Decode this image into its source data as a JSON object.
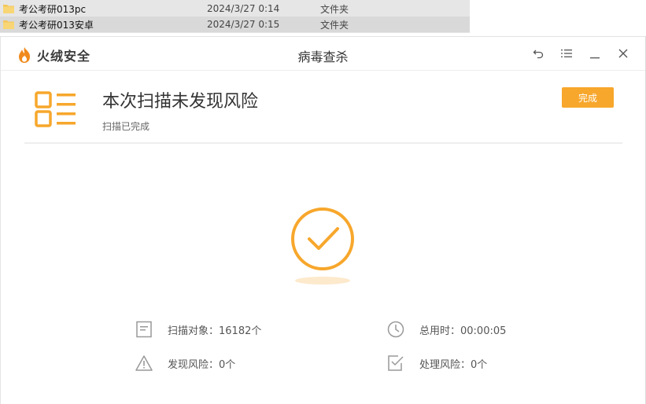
{
  "explorer": {
    "rows": [
      {
        "name": "考公考研013pc",
        "date": "2024/3/27 0:14",
        "type": "文件夹"
      },
      {
        "name": "考公考研013安卓",
        "date": "2024/3/27 0:15",
        "type": "文件夹"
      }
    ]
  },
  "app": {
    "logo_text": "火绒安全",
    "window_title": "病毒查杀",
    "accent_color": "#f7a72c"
  },
  "header": {
    "title": "本次扫描未发现风险",
    "subtitle": "扫描已完成",
    "done_button": "完成"
  },
  "stats": {
    "scan_objects": "扫描对象：16182个",
    "total_time": "总用时：00:00:05",
    "risks_found": "发现风险：0个",
    "risks_handled": "处理风险：0个"
  },
  "icons": {
    "back": "back-icon",
    "menu": "menu-icon",
    "minimize": "minimize-icon",
    "close": "close-icon"
  }
}
